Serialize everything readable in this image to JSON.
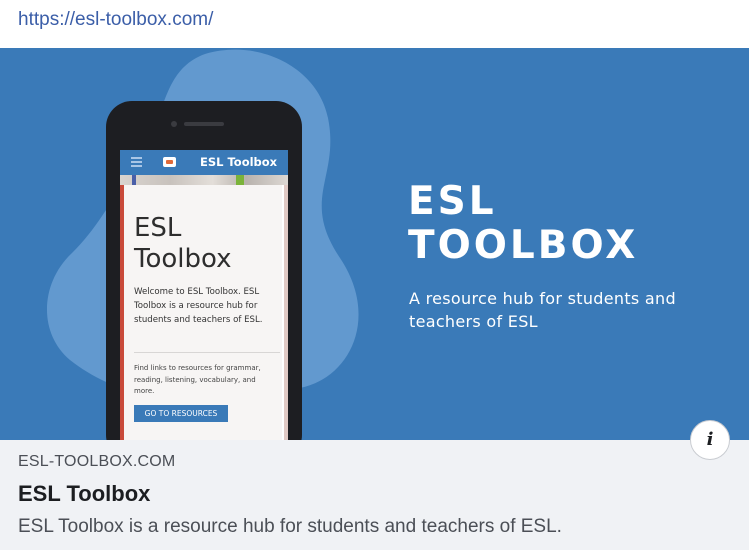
{
  "url": "https://esl-toolbox.com/",
  "banner": {
    "title": "ESL\nTOOLBOX",
    "subtitle": "A resource hub for students and teachers of ESL",
    "background_color": "#3a7ab8",
    "phone": {
      "app_title": "ESL Toolbox",
      "heading": "ESL Toolbox",
      "body": "Welcome to ESL Toolbox. ESL Toolbox is a resource hub for students and teachers of ESL.",
      "small_text": "Find links to resources for grammar, reading, listening, vocabulary, and more.",
      "button_label": "GO TO RESOURCES"
    }
  },
  "info_button": {
    "icon": "info-icon",
    "glyph": "i"
  },
  "link_preview": {
    "domain": "ESL-TOOLBOX.COM",
    "title": "ESL Toolbox",
    "description": "ESL Toolbox is a resource hub for students and teachers of ESL."
  }
}
